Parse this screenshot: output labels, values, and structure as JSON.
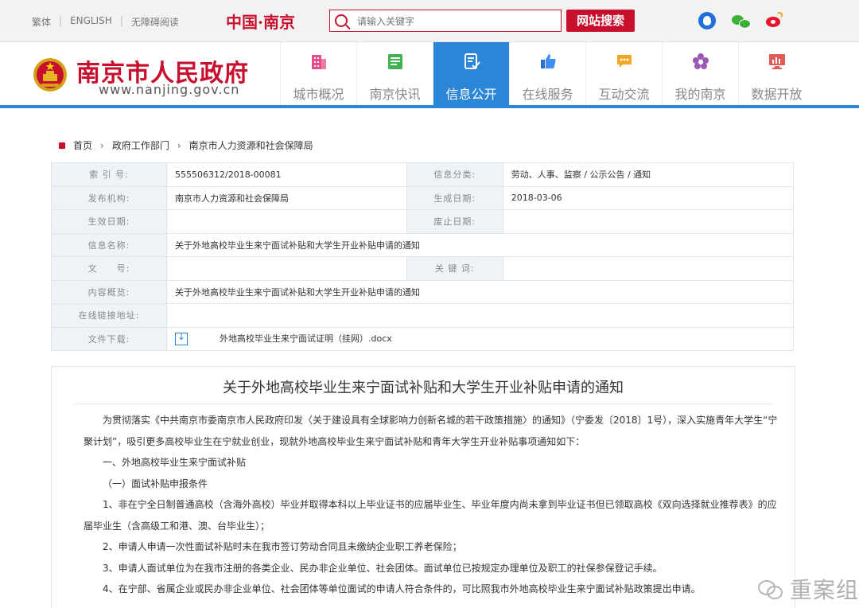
{
  "topbar": {
    "links": [
      "繁体",
      "ENGLISH",
      "无障碍阅读"
    ],
    "brand": "中国·南京",
    "search_placeholder": "请输入关键字",
    "search_button": "网站搜索"
  },
  "header": {
    "site_name": "南京市人民政府",
    "site_url": "www.nanjing.gov.cn",
    "nav": [
      {
        "label": "城市概况",
        "icon": "building-icon"
      },
      {
        "label": "南京快讯",
        "icon": "news-icon"
      },
      {
        "label": "信息公开",
        "icon": "document-check-icon",
        "active": true
      },
      {
        "label": "在线服务",
        "icon": "thumbs-up-icon"
      },
      {
        "label": "互动交流",
        "icon": "chat-icon"
      },
      {
        "label": "我的南京",
        "icon": "flower-icon"
      },
      {
        "label": "数据开放",
        "icon": "monitor-chart-icon"
      }
    ]
  },
  "breadcrumb": [
    "首页",
    "政府工作部门",
    "南京市人力资源和社会保障局"
  ],
  "meta": {
    "index_label": "索 引 号:",
    "index_value": "555506312/2018-00081",
    "category_label": "信息分类:",
    "category_value": "劳动、人事、监察 / 公示公告 / 通知",
    "publisher_label": "发布机构:",
    "publisher_value": "南京市人力资源和社会保障局",
    "created_label": "生成日期:",
    "created_value": "2018-03-06",
    "effective_label": "生效日期:",
    "effective_value": "",
    "expired_label": "废止日期:",
    "expired_value": "",
    "name_label": "信息名称:",
    "name_value": "关于外地高校毕业生来宁面试补贴和大学生开业补贴申请的通知",
    "docno_label": "文　　号:",
    "docno_value": "",
    "keywords_label": "关 键 词:",
    "keywords_value": "",
    "summary_label": "内容概览:",
    "summary_value": "关于外地高校毕业生来宁面试补贴和大学生开业补贴申请的通知",
    "link_label": "在线链接地址:",
    "link_value": "",
    "download_label": "文件下载:",
    "download_file": "外地高校毕业生来宁面试证明（挂网）.docx"
  },
  "article": {
    "title": "关于外地高校毕业生来宁面试补贴和大学生开业补贴申请的通知",
    "paragraphs": [
      "为贯彻落实《中共南京市委南京市人民政府印发〈关于建设具有全球影响力创新名城的若干政策措施〉的通知》（宁委发〔2018〕1号），深入实施青年大学生“宁聚计划”，吸引更多高校毕业生在宁就业创业，现就外地高校毕业生来宁面试补贴和青年大学生开业补贴事项通知如下：",
      "一、外地高校毕业生来宁面试补贴",
      "（一）面试补贴申报条件",
      "1、非在宁全日制普通高校（含海外高校）毕业并取得本科以上毕业证书的应届毕业生、毕业年度内尚未拿到毕业证书但已领取高校《双向选择就业推荐表》的应届毕业生（含高级工和港、澳、台毕业生）；",
      "2、申请人申请一次性面试补贴时未在我市签订劳动合同且未缴纳企业职工养老保险；",
      "3、申请人面试单位为在我市注册的各类企业、民办非企业单位、社会团体。面试单位已按规定办理单位及职工的社保参保登记手续。",
      "4、在宁部、省属企业或民办非企业单位、社会团体等单位面试的申请人符合条件的，可比照我市外地高校毕业生来宁面试补贴政策提出申请。"
    ]
  },
  "watermark": {
    "text": "重案组"
  }
}
